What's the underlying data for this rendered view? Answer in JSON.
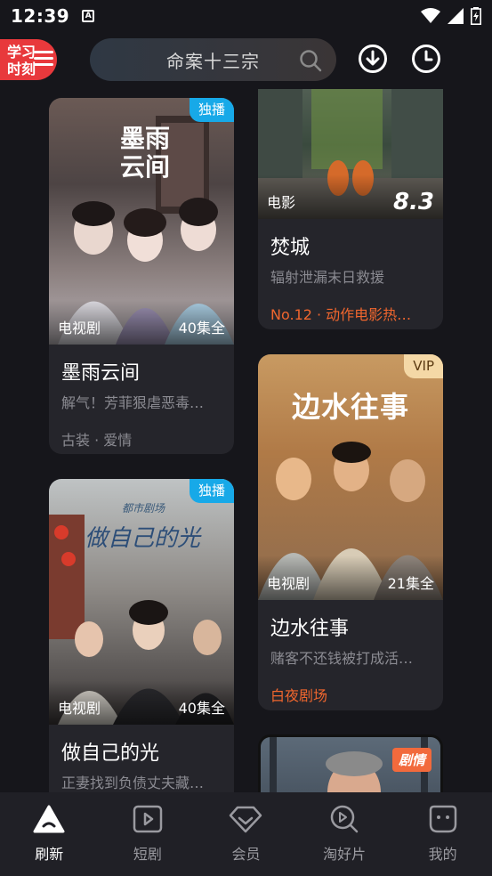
{
  "status_bar": {
    "time": "12:39",
    "notification_icon": "A"
  },
  "header": {
    "logo_line1": "学习",
    "logo_line2": "时刻",
    "search_text": "命案十三宗"
  },
  "cards": {
    "c1": {
      "badge": "独播",
      "type": "电视剧",
      "episodes": "40集全",
      "title": "墨雨云间",
      "desc": "解气！芳菲狠虐恶毒…",
      "tags": "古装 · 爱情",
      "poster_title": "墨雨云间"
    },
    "c2": {
      "type": "电影",
      "score": "8.3",
      "title": "焚城",
      "desc": "辐射泄漏末日救援",
      "rank": "No.12 · 动作电影热…"
    },
    "c3": {
      "badge": "VIP",
      "type": "电视剧",
      "episodes": "21集全",
      "title": "边水往事",
      "desc": "赌客不还钱被打成活…",
      "extra": "白夜剧场",
      "poster_title": "边水往事"
    },
    "c4": {
      "badge": "独播",
      "type": "电视剧",
      "episodes": "40集全",
      "title": "做自己的光",
      "desc": "正妻找到负债丈夫藏…",
      "poster_title": "做自己的光",
      "poster_sub": "都市剧场"
    },
    "c5": {
      "badge": "剧情"
    }
  },
  "bottom_nav": [
    {
      "label": "刷新"
    },
    {
      "label": "短剧"
    },
    {
      "label": "会员"
    },
    {
      "label": "淘好片"
    },
    {
      "label": "我的"
    }
  ]
}
